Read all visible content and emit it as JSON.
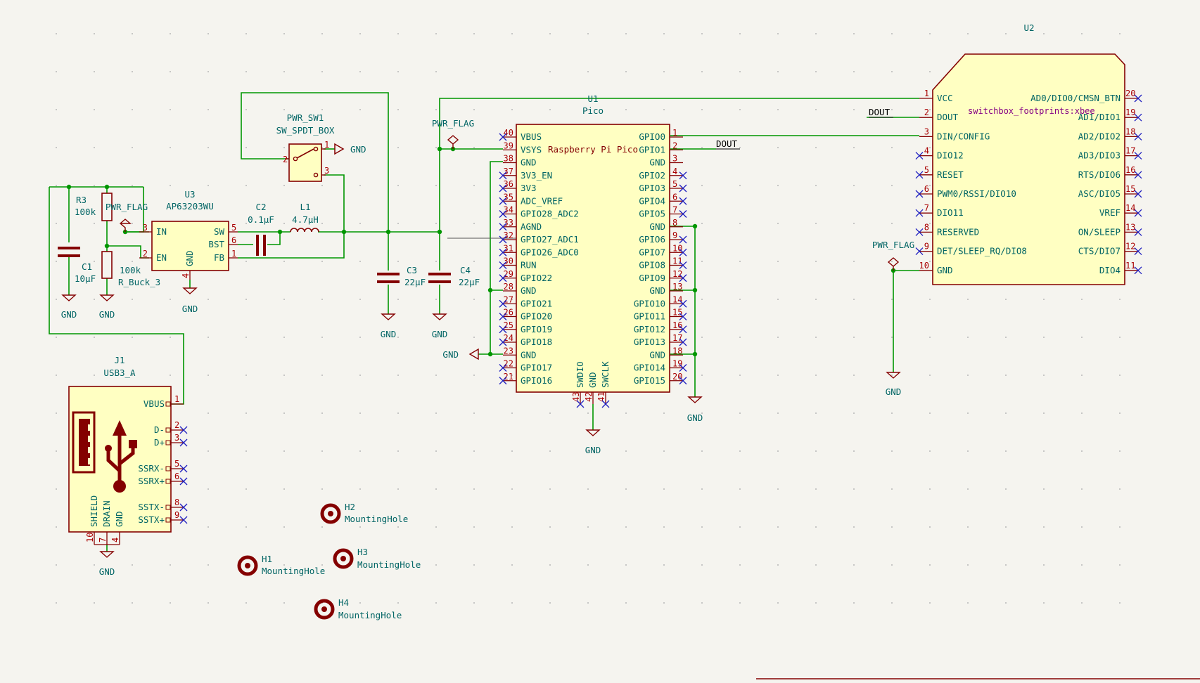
{
  "schematic": {
    "u1": {
      "ref": "U1",
      "value": "Pico",
      "inner": "Raspberry Pi Pico",
      "left_pins": [
        {
          "num": "40",
          "name": "VBUS"
        },
        {
          "num": "39",
          "name": "VSYS"
        },
        {
          "num": "38",
          "name": "GND"
        },
        {
          "num": "37",
          "name": "3V3_EN"
        },
        {
          "num": "36",
          "name": "3V3"
        },
        {
          "num": "35",
          "name": "ADC_VREF"
        },
        {
          "num": "34",
          "name": "GPIO28_ADC2"
        },
        {
          "num": "33",
          "name": "AGND"
        },
        {
          "num": "32",
          "name": "GPIO27_ADC1"
        },
        {
          "num": "31",
          "name": "GPIO26_ADC0"
        },
        {
          "num": "30",
          "name": "RUN"
        },
        {
          "num": "29",
          "name": "GPIO22"
        },
        {
          "num": "28",
          "name": "GND"
        },
        {
          "num": "27",
          "name": "GPIO21"
        },
        {
          "num": "26",
          "name": "GPIO20"
        },
        {
          "num": "25",
          "name": "GPIO19"
        },
        {
          "num": "24",
          "name": "GPIO18"
        },
        {
          "num": "23",
          "name": "GND"
        },
        {
          "num": "22",
          "name": "GPIO17"
        },
        {
          "num": "21",
          "name": "GPIO16"
        }
      ],
      "right_pins": [
        {
          "num": "1",
          "name": "GPIO0"
        },
        {
          "num": "2",
          "name": "GPIO1"
        },
        {
          "num": "3",
          "name": "GND"
        },
        {
          "num": "4",
          "name": "GPIO2"
        },
        {
          "num": "5",
          "name": "GPIO3"
        },
        {
          "num": "6",
          "name": "GPIO4"
        },
        {
          "num": "7",
          "name": "GPIO5"
        },
        {
          "num": "8",
          "name": "GND"
        },
        {
          "num": "9",
          "name": "GPIO6"
        },
        {
          "num": "10",
          "name": "GPIO7"
        },
        {
          "num": "11",
          "name": "GPIO8"
        },
        {
          "num": "12",
          "name": "GPIO9"
        },
        {
          "num": "13",
          "name": "GND"
        },
        {
          "num": "14",
          "name": "GPIO10"
        },
        {
          "num": "15",
          "name": "GPIO11"
        },
        {
          "num": "16",
          "name": "GPIO12"
        },
        {
          "num": "17",
          "name": "GPIO13"
        },
        {
          "num": "18",
          "name": "GND"
        },
        {
          "num": "19",
          "name": "GPIO14"
        },
        {
          "num": "20",
          "name": "GPIO15"
        }
      ],
      "bottom_pins": [
        {
          "num": "43",
          "name": "SWDIO"
        },
        {
          "num": "42",
          "name": "GND"
        },
        {
          "num": "41",
          "name": "SWCLK"
        }
      ]
    },
    "u2": {
      "ref": "U2",
      "footprint": "switchbox_footprints:xbee",
      "left_pins": [
        {
          "num": "1",
          "name": "VCC"
        },
        {
          "num": "2",
          "name": "DOUT"
        },
        {
          "num": "3",
          "name": "DIN/CONFIG"
        },
        {
          "num": "4",
          "name": "DIO12"
        },
        {
          "num": "5",
          "name": "RESET"
        },
        {
          "num": "6",
          "name": "PWM0/RSSI/DIO10"
        },
        {
          "num": "7",
          "name": "DIO11"
        },
        {
          "num": "8",
          "name": "RESERVED"
        },
        {
          "num": "9",
          "name": "DET/SLEEP_RQ/DIO8"
        },
        {
          "num": "10",
          "name": "GND"
        }
      ],
      "right_pins": [
        {
          "num": "20",
          "name": "AD0/DIO0/CMSN_BTN"
        },
        {
          "num": "19",
          "name": "AD1/DIO1"
        },
        {
          "num": "18",
          "name": "AD2/DIO2"
        },
        {
          "num": "17",
          "name": "AD3/DIO3"
        },
        {
          "num": "16",
          "name": "RTS/DIO6"
        },
        {
          "num": "15",
          "name": "ASC/DIO5"
        },
        {
          "num": "14",
          "name": "VREF"
        },
        {
          "num": "13",
          "name": "ON/SLEEP"
        },
        {
          "num": "12",
          "name": "CTS/DIO7"
        },
        {
          "num": "11",
          "name": "DIO4"
        }
      ]
    },
    "u3": {
      "ref": "U3",
      "value": "AP63203WU",
      "pins": [
        {
          "num": "3",
          "name": "IN"
        },
        {
          "num": "2",
          "name": "EN"
        },
        {
          "num": "4",
          "name": "GND"
        },
        {
          "num": "5",
          "name": "SW"
        },
        {
          "num": "6",
          "name": "BST"
        },
        {
          "num": "1",
          "name": "FB"
        }
      ]
    },
    "j1": {
      "ref": "J1",
      "value": "USB3_A",
      "right_pins": [
        {
          "num": "1",
          "name": "VBUS"
        },
        {
          "num": "2",
          "name": "D-"
        },
        {
          "num": "3",
          "name": "D+"
        },
        {
          "num": "5",
          "name": "SSRX-"
        },
        {
          "num": "6",
          "name": "SSRX+"
        },
        {
          "num": "8",
          "name": "SSTX-"
        },
        {
          "num": "9",
          "name": "SSTX+"
        }
      ],
      "bottom_pins": [
        {
          "num": "10",
          "name": "SHIELD"
        },
        {
          "num": "7",
          "name": "DRAIN"
        },
        {
          "num": "4",
          "name": "GND"
        }
      ]
    },
    "sw": {
      "ref": "PWR_SW1",
      "value": "SW_SPDT_BOX",
      "pins": [
        "1",
        "2",
        "3"
      ]
    },
    "passives": {
      "r3": {
        "ref": "R3",
        "value": "100k"
      },
      "r_buck": {
        "ref": "100k",
        "value": "R_Buck_3"
      },
      "c1": {
        "ref": "C1",
        "value": "10µF"
      },
      "c2": {
        "ref": "C2",
        "value": "0.1µF"
      },
      "l1": {
        "ref": "L1",
        "value": "4.7µH"
      },
      "c3": {
        "ref": "C3",
        "value": "22µF"
      },
      "c4": {
        "ref": "C4",
        "value": "22µF"
      }
    },
    "holes": [
      {
        "ref": "H1",
        "value": "MountingHole"
      },
      {
        "ref": "H2",
        "value": "MountingHole"
      },
      {
        "ref": "H3",
        "value": "MountingHole"
      },
      {
        "ref": "H4",
        "value": "MountingHole"
      }
    ],
    "power": {
      "gnd": "GND",
      "pwr_flag": "PWR_FLAG"
    },
    "net_labels": {
      "dout": "DOUT"
    }
  }
}
